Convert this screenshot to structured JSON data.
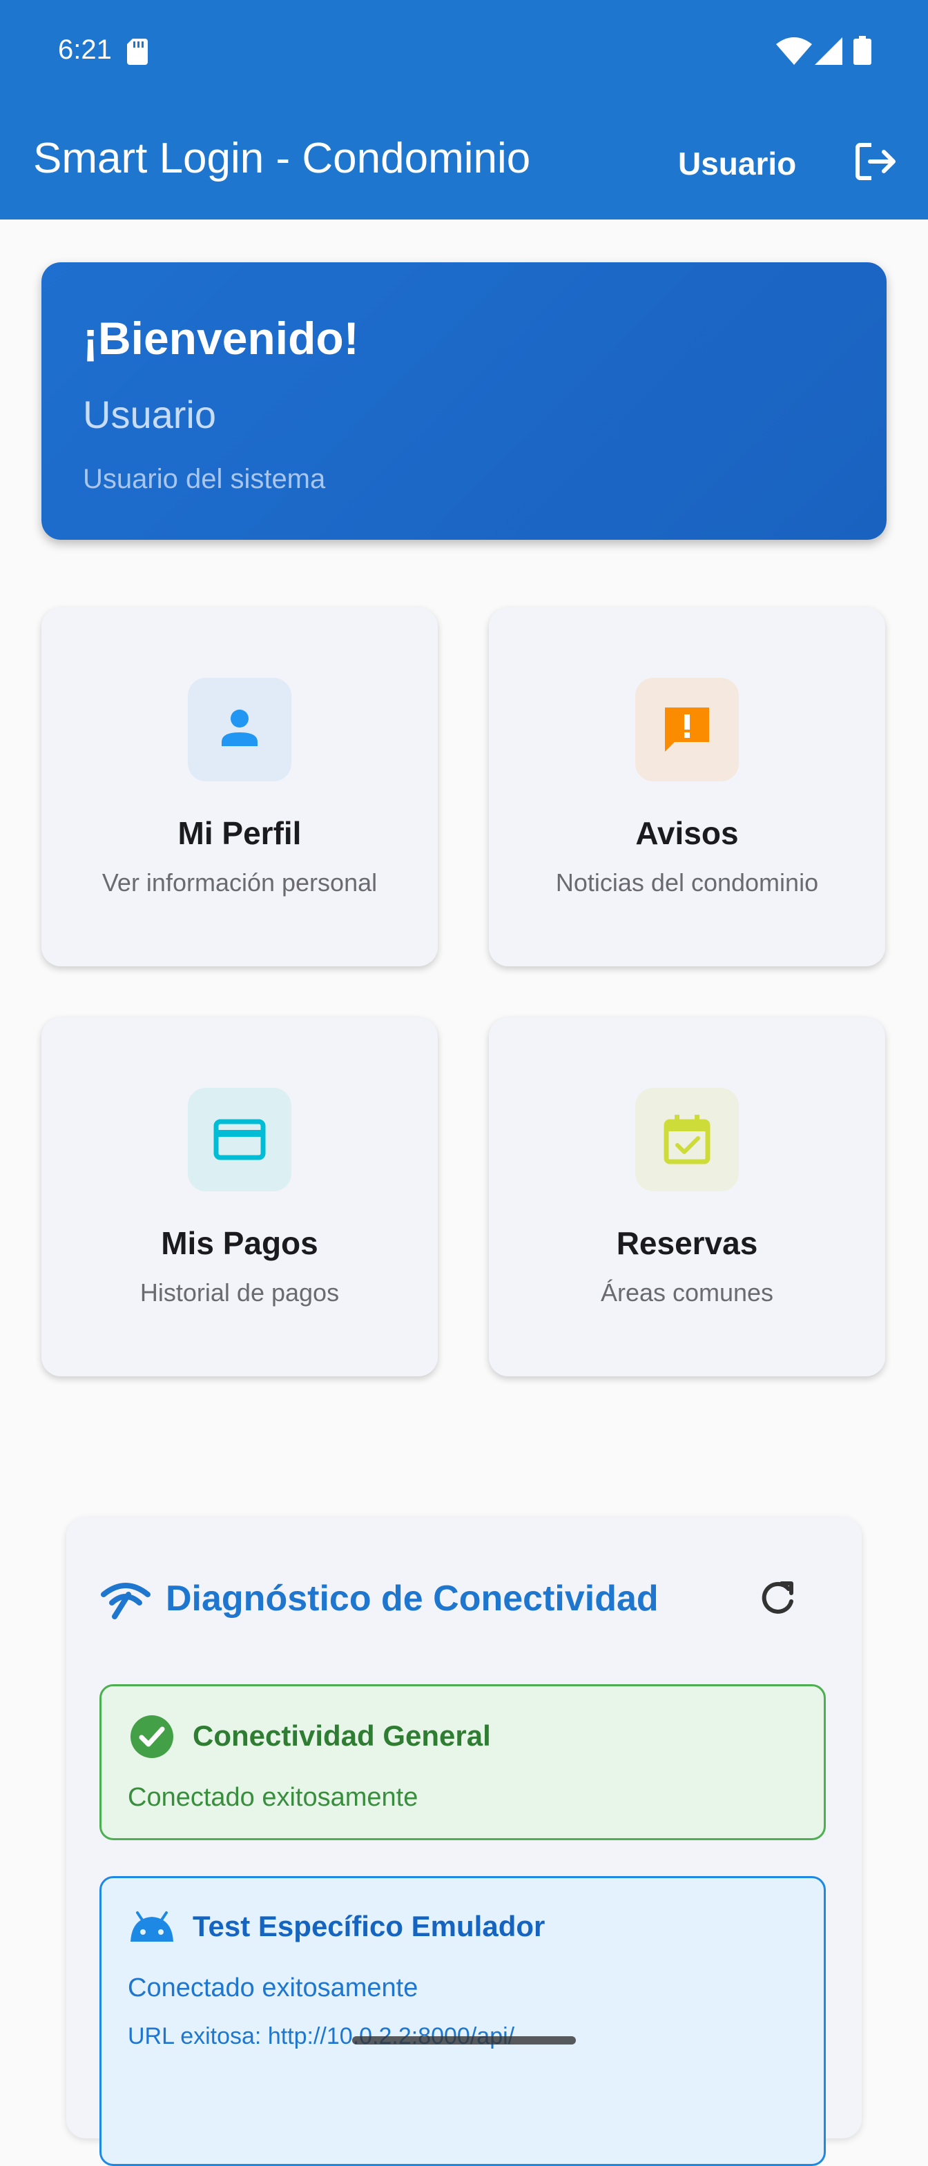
{
  "status_bar": {
    "time": "6:21"
  },
  "app_bar": {
    "title": "Smart Login - Condominio",
    "user_label": "Usuario"
  },
  "welcome": {
    "title": "¡Bienvenido!",
    "name": "Usuario",
    "role": "Usuario del sistema"
  },
  "cards": [
    {
      "title": "Mi Perfil",
      "subtitle": "Ver información personal",
      "icon": "person-icon",
      "color": "#2196f3",
      "bg": "#e1ebf8"
    },
    {
      "title": "Avisos",
      "subtitle": "Noticias del condominio",
      "icon": "announcement-icon",
      "color": "#fb8c00",
      "bg": "#f5e8df"
    },
    {
      "title": "Mis Pagos",
      "subtitle": "Historial de pagos",
      "icon": "credit-card-icon",
      "color": "#00bcd4",
      "bg": "#dcf0f4"
    },
    {
      "title": "Reservas",
      "subtitle": "Áreas comunes",
      "icon": "calendar-check-icon",
      "color": "#cddc39",
      "bg": "#eef1e2"
    }
  ],
  "diagnostics": {
    "title": "Diagnóstico de Conectividad",
    "general": {
      "title": "Conectividad General",
      "status": "Conectado exitosamente"
    },
    "emulator": {
      "title": "Test Específico Emulador",
      "status": "Conectado exitosamente",
      "url_text": "URL exitosa: http://10.0.2.2:8000/api/"
    }
  }
}
